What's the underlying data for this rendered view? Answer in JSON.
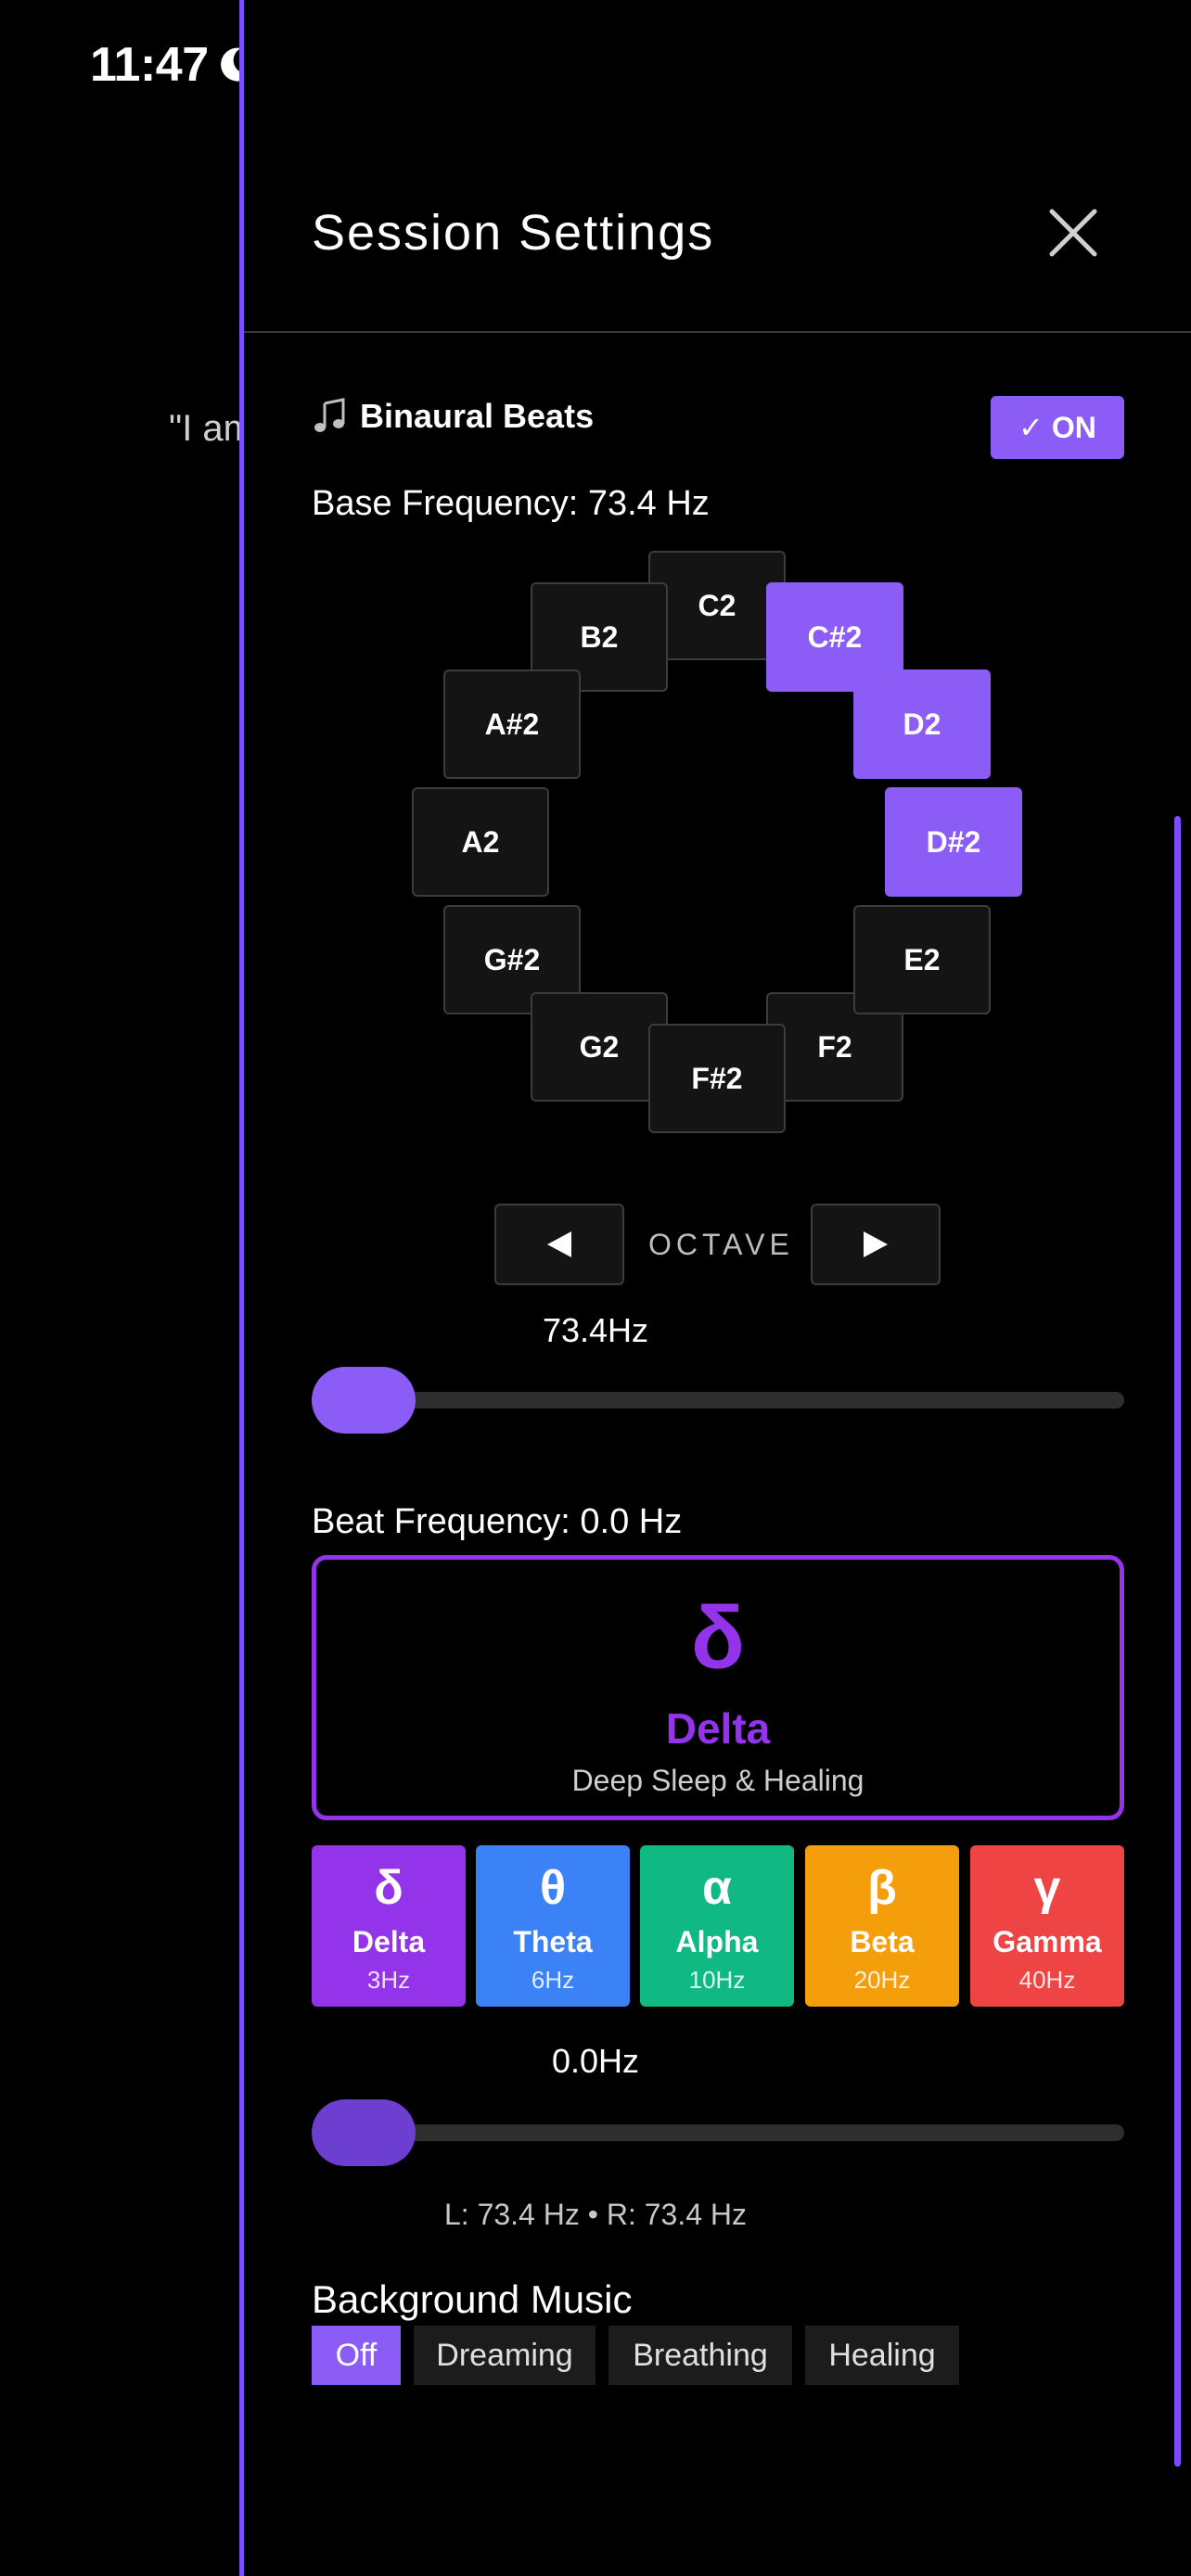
{
  "status_bar": {
    "time": "11:47"
  },
  "background": {
    "quote_text": "\"I am"
  },
  "sheet": {
    "title": "Session Settings",
    "binaural": {
      "label": "Binaural Beats",
      "toggle_label": "✓ ON",
      "base_frequency_label": "Base Frequency: 73.4 Hz",
      "notes": [
        "C2",
        "C#2",
        "D2",
        "D#2",
        "E2",
        "F2",
        "F#2",
        "G2",
        "G#2",
        "A2",
        "A#2",
        "B2"
      ],
      "active_notes": [
        "C#2",
        "D2",
        "D#2"
      ],
      "octave_label": "OCTAVE",
      "base_value_label": "73.4Hz",
      "base_slider_level": 0,
      "beat_frequency_label": "Beat Frequency: 0.0 Hz",
      "selected_wave": {
        "symbol": "δ",
        "name": "Delta",
        "description": "Deep Sleep & Healing"
      },
      "presets": [
        {
          "symbol": "δ",
          "name": "Delta",
          "hz": "3Hz",
          "color": "#9333ea"
        },
        {
          "symbol": "θ",
          "name": "Theta",
          "hz": "6Hz",
          "color": "#3b82f6"
        },
        {
          "symbol": "α",
          "name": "Alpha",
          "hz": "10Hz",
          "color": "#10b981"
        },
        {
          "symbol": "β",
          "name": "Beta",
          "hz": "20Hz",
          "color": "#f59e0b"
        },
        {
          "symbol": "γ",
          "name": "Gamma",
          "hz": "40Hz",
          "color": "#ef4444"
        }
      ],
      "beat_value_label": "0.0Hz",
      "beat_slider_level": 0,
      "lr_readout": "L: 73.4 Hz • R: 73.4 Hz"
    },
    "background_music": {
      "title": "Background Music",
      "options": [
        "Off",
        "Dreaming",
        "Breathing",
        "Healing"
      ],
      "selected": "Off"
    }
  },
  "colors": {
    "accent": "#8b5cf6",
    "delta": "#9333ea"
  }
}
